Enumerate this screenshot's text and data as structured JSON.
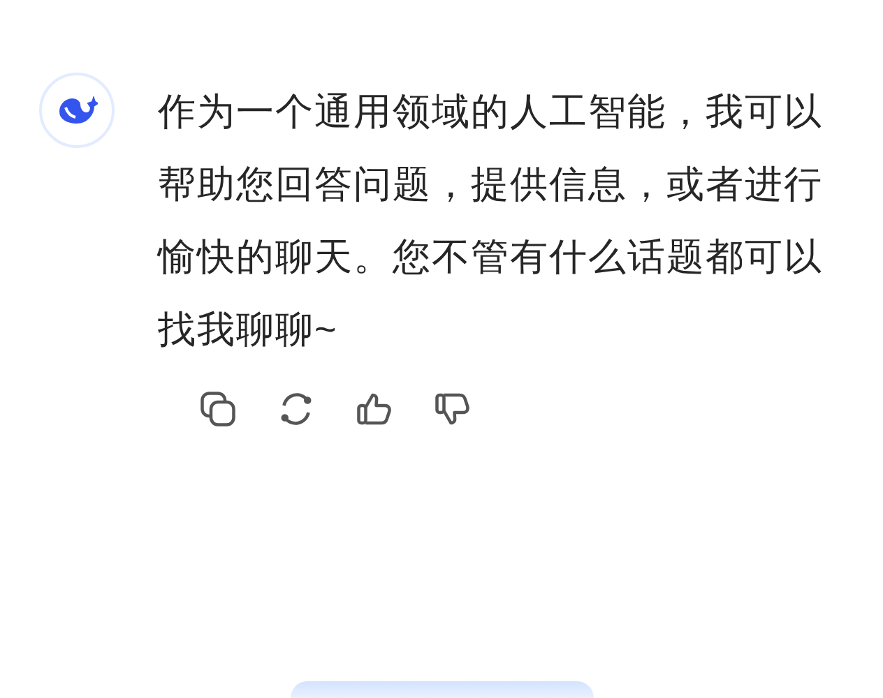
{
  "message": {
    "text": "作为一个通用领域的人工智能，我可以帮助您回答问题，提供信息，或者进行愉快的聊天。您不管有什么话题都可以找我聊聊~"
  }
}
